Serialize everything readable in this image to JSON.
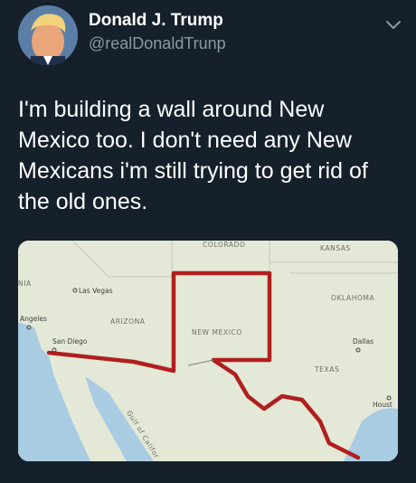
{
  "tweet": {
    "author_name": "Donald J. Trump",
    "author_handle": "@realDonaldTrunp",
    "text": "I'm building a wall around New Mexico too. I don't need any New Mexicans i'm still trying to get rid of the old ones."
  },
  "map": {
    "labels": {
      "colorado": "COLORADO",
      "kansas": "KANSAS",
      "california": "NIA",
      "las_vegas": "Las Vegas",
      "oklahoma": "OKLAHOMA",
      "los_angeles": "Angeles",
      "arizona": "ARIZONA",
      "new_mexico": "NEW MEXICO",
      "san_diego": "San Diego",
      "dallas": "Dallas",
      "texas": "TEXAS",
      "houston": "Houst",
      "gulf": "Gulf of Califor"
    },
    "colors": {
      "wall": "#b01f1f",
      "water": "#a9cce3",
      "land": "#e4e8d6"
    }
  },
  "icons": {
    "chevron": "chevron-down-icon",
    "avatar": "profile-photo"
  }
}
